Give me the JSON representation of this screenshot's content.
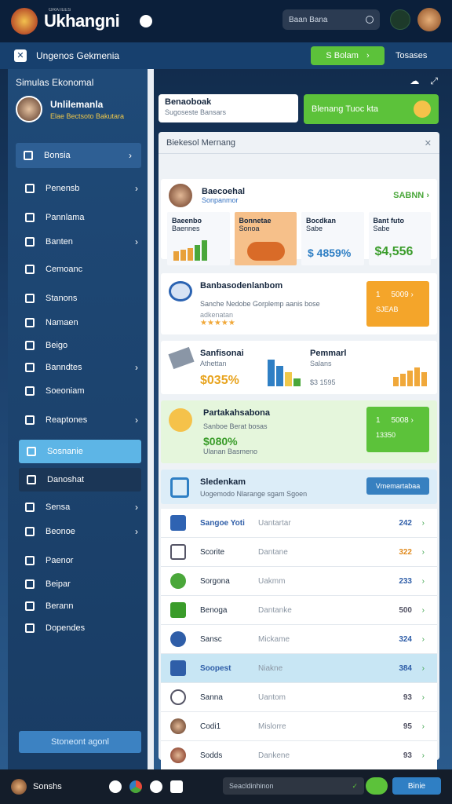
{
  "header": {
    "brand": "Ukhangni",
    "brand_small": "GRATEES",
    "search_placeholder": "Baan Bana"
  },
  "subbar": {
    "title": "Ungenos Gekmenia",
    "button": "S Bolam",
    "right": "Tosases"
  },
  "sidebar": {
    "title": "Simulas Ekonomal",
    "profile_name": "Unlilemanla",
    "profile_sub": "Elae Bectsoto Bakutara",
    "items": [
      {
        "label": "Bonsia"
      },
      {
        "label": "Penensb"
      },
      {
        "label": "Pannlama"
      },
      {
        "label": "Banten"
      },
      {
        "label": "Cemoanc"
      },
      {
        "label": "Stanons"
      },
      {
        "label": "Namaen"
      },
      {
        "label": "Beigo"
      },
      {
        "label": "Banndtes"
      },
      {
        "label": "Soeoniam"
      },
      {
        "label": "Reaptones"
      },
      {
        "label": "Sosnanie"
      },
      {
        "label": "Danoshat"
      },
      {
        "label": "Sensa"
      },
      {
        "label": "Beonoe"
      },
      {
        "label": "Paenor"
      },
      {
        "label": "Beipar"
      },
      {
        "label": "Berann"
      },
      {
        "label": "Dopendes"
      }
    ],
    "footer": "Stoneont agonl"
  },
  "main": {
    "card1_title": "Benaoboak",
    "card1_sub": "Sugoseste Bansars",
    "card2": "Blenang Tuoc kta",
    "panel_title": "Biekesol Mernang",
    "s1": {
      "title": "Baecoehal",
      "sub": "Sonpanmor",
      "link": "SABNN",
      "tiles": [
        {
          "title": "Baeenbo",
          "sub": "Baennes"
        },
        {
          "title": "Bonnetae",
          "sub": "Sonoa"
        },
        {
          "title": "Bocdkan",
          "sub": "Sabe",
          "value": "$ 4859%"
        },
        {
          "title": "Bant futo",
          "sub": "Sabe",
          "value": "$4,556"
        }
      ]
    },
    "s2": {
      "title": "Banbasodenlanbom",
      "line1": "Sanche Nedobe Gorplemp aanis bose",
      "line2": "adkenatan",
      "stars": "★★★★★ ",
      "obox_a": "1",
      "obox_b": "5009",
      "obox_c": "SJEAB"
    },
    "s3": {
      "title": "Sanfisonai",
      "line": "Athettan",
      "value": "$035%",
      "title2": "Pemmarl",
      "line2": "Salans",
      "value2": "$3 1595"
    },
    "s4": {
      "title": "Partakahsabona",
      "line": "Sanboe Berat bosas",
      "value": "$080%",
      "line2": "Ulanan Basmeno",
      "gbox_a": "1",
      "gbox_b": "5008",
      "gbox_c": "13350"
    },
    "list": {
      "title": "Sledenkam",
      "sub": "Uogemodo Nlarange sgam Sgoen",
      "button": "Vmemartabaa",
      "rows": [
        {
          "name": "Sangoe Yoti",
          "status": "Uantartar",
          "value": "242"
        },
        {
          "name": "Scorite",
          "status": "Dantane",
          "value": "322"
        },
        {
          "name": "Sorgona",
          "status": "Uakmm",
          "value": "233"
        },
        {
          "name": "Benoga",
          "status": "Dantanke",
          "value": "500"
        },
        {
          "name": "Sansc",
          "status": "Mickame",
          "value": "324"
        },
        {
          "name": "Soopest",
          "status": "Niakne",
          "value": "384"
        },
        {
          "name": "Sanna",
          "status": "Uantom",
          "value": "93"
        },
        {
          "name": "Codi1",
          "status": "Mislorre",
          "value": "95"
        },
        {
          "name": "Sodds",
          "status": "Dankene",
          "value": "93"
        }
      ]
    }
  },
  "footer": {
    "user": "Sonshs",
    "search": "Seacldinhinon",
    "button": "Binie"
  }
}
